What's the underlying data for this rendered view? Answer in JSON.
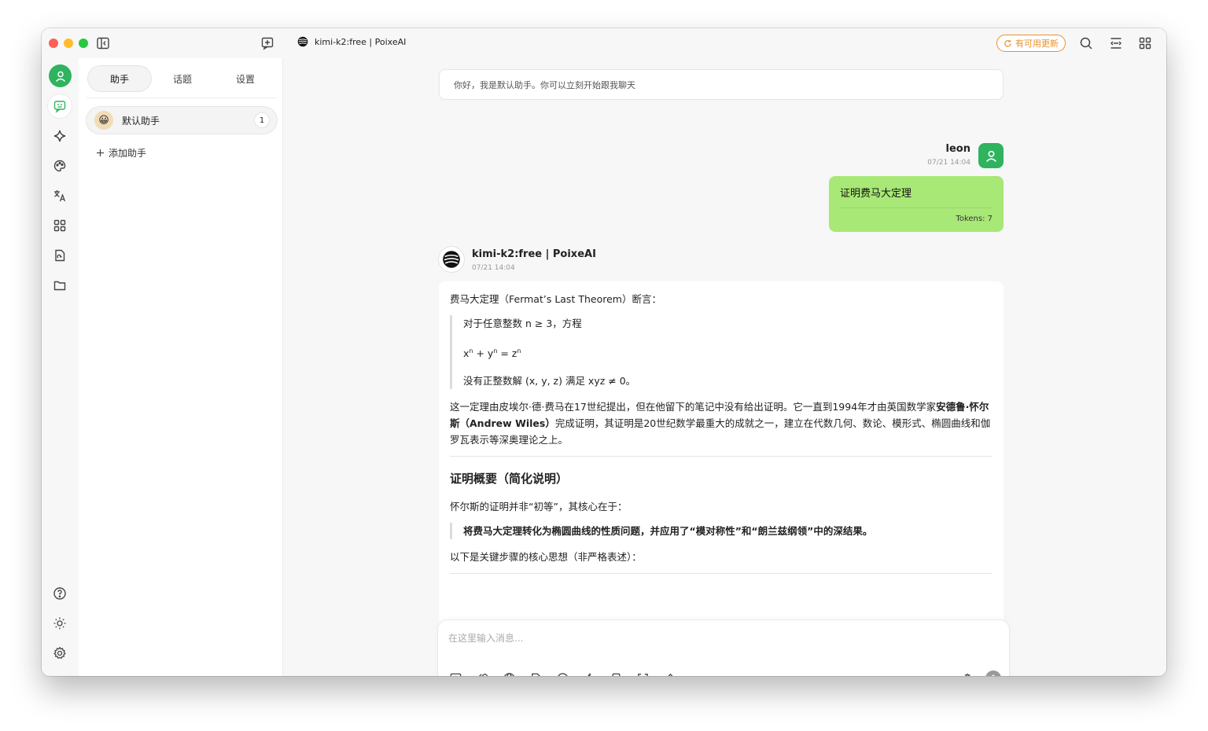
{
  "titlebar": {
    "title": "kimi-k2:free | PoixeAI",
    "update_label": "有可用更新"
  },
  "sidebar": {
    "tabs": [
      {
        "label": "助手",
        "active": true
      },
      {
        "label": "话题",
        "active": false
      },
      {
        "label": "设置",
        "active": false
      }
    ],
    "assistant": {
      "emoji": "😀",
      "name": "默认助手",
      "count": "1"
    },
    "add_label": "添加助手"
  },
  "chat": {
    "greeting": "你好，我是默认助手。你可以立刻开始跟我聊天",
    "user": {
      "name": "leon",
      "time": "07/21 14:04",
      "message": "证明费马大定理",
      "tokens": "Tokens: 7"
    },
    "bot": {
      "name": "kimi-k2:free | PoixeAI",
      "time": "07/21 14:04",
      "intro": "费马大定理（Fermat’s Last Theorem）断言：",
      "quote_line1": "对于任意整数 n ≥ 3，方程",
      "eq_x": "x",
      "eq_plus": " + y",
      "eq_eq": " = z",
      "eq_n": "n",
      "quote_line3": "没有正整数解 (x, y, z) 满足 xyz ≠ 0。",
      "para_a": "这一定理由皮埃尔·德·费马在17世纪提出，但在他留下的笔记中没有给出证明。它一直到1994年才由英国数学家",
      "para_bold": "安德鲁·怀尔斯（Andrew Wiles）",
      "para_b": "完成证明，其证明是20世纪数学最重大的成就之一，建立在代数几何、数论、模形式、椭圆曲线和伽罗瓦表示等深奥理论之上。",
      "heading": "证明概要（简化说明）",
      "core_intro": "怀尔斯的证明并非“初等”，其核心在于：",
      "core_quote": "将费马大定理转化为椭圆曲线的性质问题，并应用了“模对称性”和“朗兰兹纲领”中的深结果。",
      "steps_intro": "以下是关键步骤的核心思想（非严格表述）："
    }
  },
  "input": {
    "placeholder": "在这里输入消息..."
  },
  "colors": {
    "accent": "#2fb35f",
    "user_bubble": "#a8e876",
    "update_badge": "#e8912b"
  }
}
